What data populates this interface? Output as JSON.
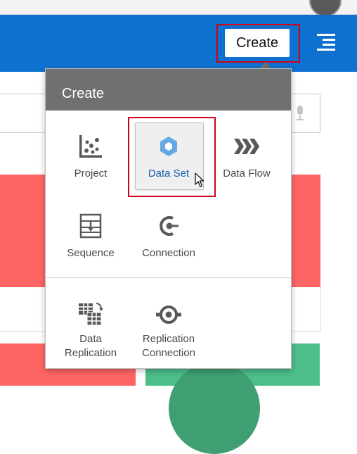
{
  "header": {
    "create_button_label": "Create",
    "menu_icon": "hamburger-icon",
    "bar_color": "#0f71cf"
  },
  "dropdown": {
    "title": "Create",
    "items": [
      {
        "label": "Project",
        "icon": "project-icon",
        "highlighted": false
      },
      {
        "label": "Data Set",
        "icon": "data-set-icon",
        "highlighted": true
      },
      {
        "label": "Data Flow",
        "icon": "data-flow-icon",
        "highlighted": false
      },
      {
        "label": "Sequence",
        "icon": "sequence-icon",
        "highlighted": false
      },
      {
        "label": "Connection",
        "icon": "connection-icon",
        "highlighted": false
      }
    ],
    "replication_items": [
      {
        "label_line1": "Data",
        "label_line2": "Replication",
        "icon": "data-replication-icon"
      },
      {
        "label_line1": "Replication",
        "label_line2": "Connection",
        "icon": "replication-connection-icon"
      }
    ]
  },
  "colors": {
    "highlight_border": "#d0021b",
    "selected_item_text": "#1a5fb4",
    "accent_icon": "#66a9e2"
  }
}
